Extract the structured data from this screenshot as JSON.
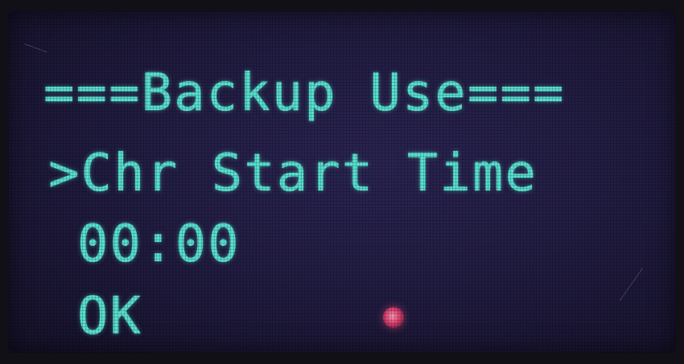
{
  "display": {
    "title": "===Backup Use===",
    "menu_item": ">Chr Start Time",
    "time_value": "00:00",
    "ok_option": "OK"
  },
  "colors": {
    "text": "#57e0cf",
    "screen_background": "#221d43",
    "indicator_led": "#d8406e"
  }
}
